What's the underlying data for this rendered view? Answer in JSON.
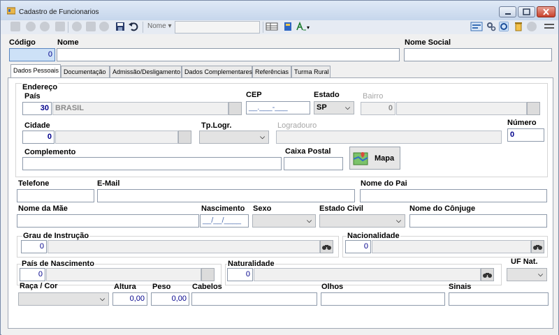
{
  "window": {
    "title": "Cadastro de Funcionarios"
  },
  "toolbar": {
    "search_label": "Nome",
    "search_value": ""
  },
  "header": {
    "codigo_label": "Código",
    "codigo_value": "0",
    "nome_label": "Nome",
    "nome_value": "",
    "nome_social_label": "Nome Social",
    "nome_social_value": ""
  },
  "tabs": [
    {
      "label": "Dados Pessoais"
    },
    {
      "label": "Documentação"
    },
    {
      "label": "Admissão/Desligamento"
    },
    {
      "label": "Dados Complementares"
    },
    {
      "label": "Referências"
    },
    {
      "label": "Turma Rural"
    }
  ],
  "endereco": {
    "group_label": "Endereço",
    "pais_label": "País",
    "pais_code": "30",
    "pais_name": "BRASIL",
    "cep_label": "CEP",
    "cep_value": "__.___-___",
    "estado_label": "Estado",
    "estado_value": "SP",
    "bairro_label": "Bairro",
    "bairro_code": "0",
    "cidade_label": "Cidade",
    "cidade_code": "0",
    "tplogr_label": "Tp.Logr.",
    "logradouro_label": "Logradouro",
    "numero_label": "Número",
    "numero_value": "0",
    "complemento_label": "Complemento",
    "caixa_postal_label": "Caixa Postal",
    "mapa_label": "Mapa"
  },
  "pessoais": {
    "telefone_label": "Telefone",
    "email_label": "E-Mail",
    "nome_pai_label": "Nome do Pai",
    "nome_mae_label": "Nome da Mãe",
    "nascimento_label": "Nascimento",
    "nascimento_value": "__/__/____",
    "sexo_label": "Sexo",
    "estado_civil_label": "Estado Civil",
    "nome_conjuge_label": "Nome do Cônjuge",
    "grau_label": "Grau de Instrução",
    "grau_code": "0",
    "nacionalidade_label": "Nacionalidade",
    "nacionalidade_code": "0",
    "pais_nasc_label": "País de Nascimento",
    "pais_nasc_code": "0",
    "naturalidade_label": "Naturalidade",
    "naturalidade_code": "0",
    "uf_nat_label": "UF Nat.",
    "raca_label": "Raça / Cor",
    "altura_label": "Altura",
    "altura_value": "0,00",
    "peso_label": "Peso",
    "peso_value": "0,00",
    "cabelos_label": "Cabelos",
    "olhos_label": "Olhos",
    "sinais_label": "Sinais"
  }
}
